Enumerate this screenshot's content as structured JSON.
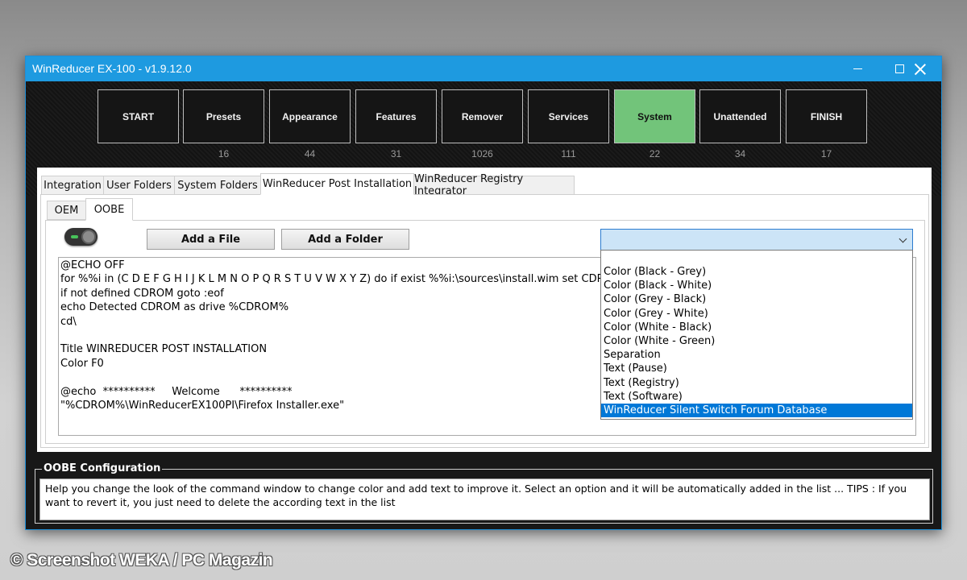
{
  "window": {
    "title": "WinReducer EX-100 - v1.9.12.0",
    "controls": [
      "minimize-icon",
      "maximize-icon",
      "close-icon"
    ]
  },
  "steps": [
    {
      "label": "START",
      "count": ""
    },
    {
      "label": "Presets",
      "count": "16"
    },
    {
      "label": "Appearance",
      "count": "44"
    },
    {
      "label": "Features",
      "count": "31"
    },
    {
      "label": "Remover",
      "count": "1026"
    },
    {
      "label": "Services",
      "count": "111"
    },
    {
      "label": "System",
      "count": "22",
      "active": true
    },
    {
      "label": "Unattended",
      "count": "34"
    },
    {
      "label": "FINISH",
      "count": "17"
    }
  ],
  "tabs": [
    "Integration",
    "User Folders",
    "System Folders",
    "WinReducer Post Installation",
    "WinReducer Registry Integrator"
  ],
  "active_tab": "WinReducer Post Installation",
  "subtabs": [
    "OEM",
    "OOBE"
  ],
  "active_subtab": "OOBE",
  "toolbar": {
    "toggle_on": true,
    "add_file_label": "Add a File",
    "add_folder_label": "Add a Folder",
    "combo_value": ""
  },
  "editor": {
    "lines": [
      "@ECHO OFF",
      "for %%i in (C D E F G H I J K L M N O P Q R S T U V W X Y Z) do if exist %%i:\\sources\\install.wim set CDROM=%",
      "if not defined CDROM goto :eof",
      "echo Detected CDROM as drive %CDROM%",
      "cd\\",
      "",
      "Title WINREDUCER POST INSTALLATION",
      "Color F0",
      "",
      "@echo  **********     Welcome      **********",
      "\"%CDROM%\\WinReducerEX100PI\\Firefox Installer.exe\""
    ]
  },
  "dropdown": {
    "options": [
      "Color (Black - Grey)",
      "Color (Black - White)",
      "Color (Grey - Black)",
      "Color (Grey - White)",
      "Color (White - Black)",
      "Color (White - Green)",
      "Separation",
      "Text (Pause)",
      "Text (Registry)",
      "Text (Software)",
      "WinReducer Silent Switch Forum Database"
    ],
    "selected": "WinReducer Silent Switch Forum Database"
  },
  "config": {
    "title": "OOBE Configuration",
    "text": "Help you change the look of the command window to change color and add text to improve it. Select an option and it will be automatically added in the list ... TIPS : If you want to revert it, you just need to delete the according text in the list"
  },
  "watermark": "© Screenshot WEKA / PC Magazin",
  "colors": {
    "titlebar": "#1e9ae0",
    "active_step": "#72c47a",
    "selection": "#0078d7",
    "window_bg": "#181818"
  }
}
